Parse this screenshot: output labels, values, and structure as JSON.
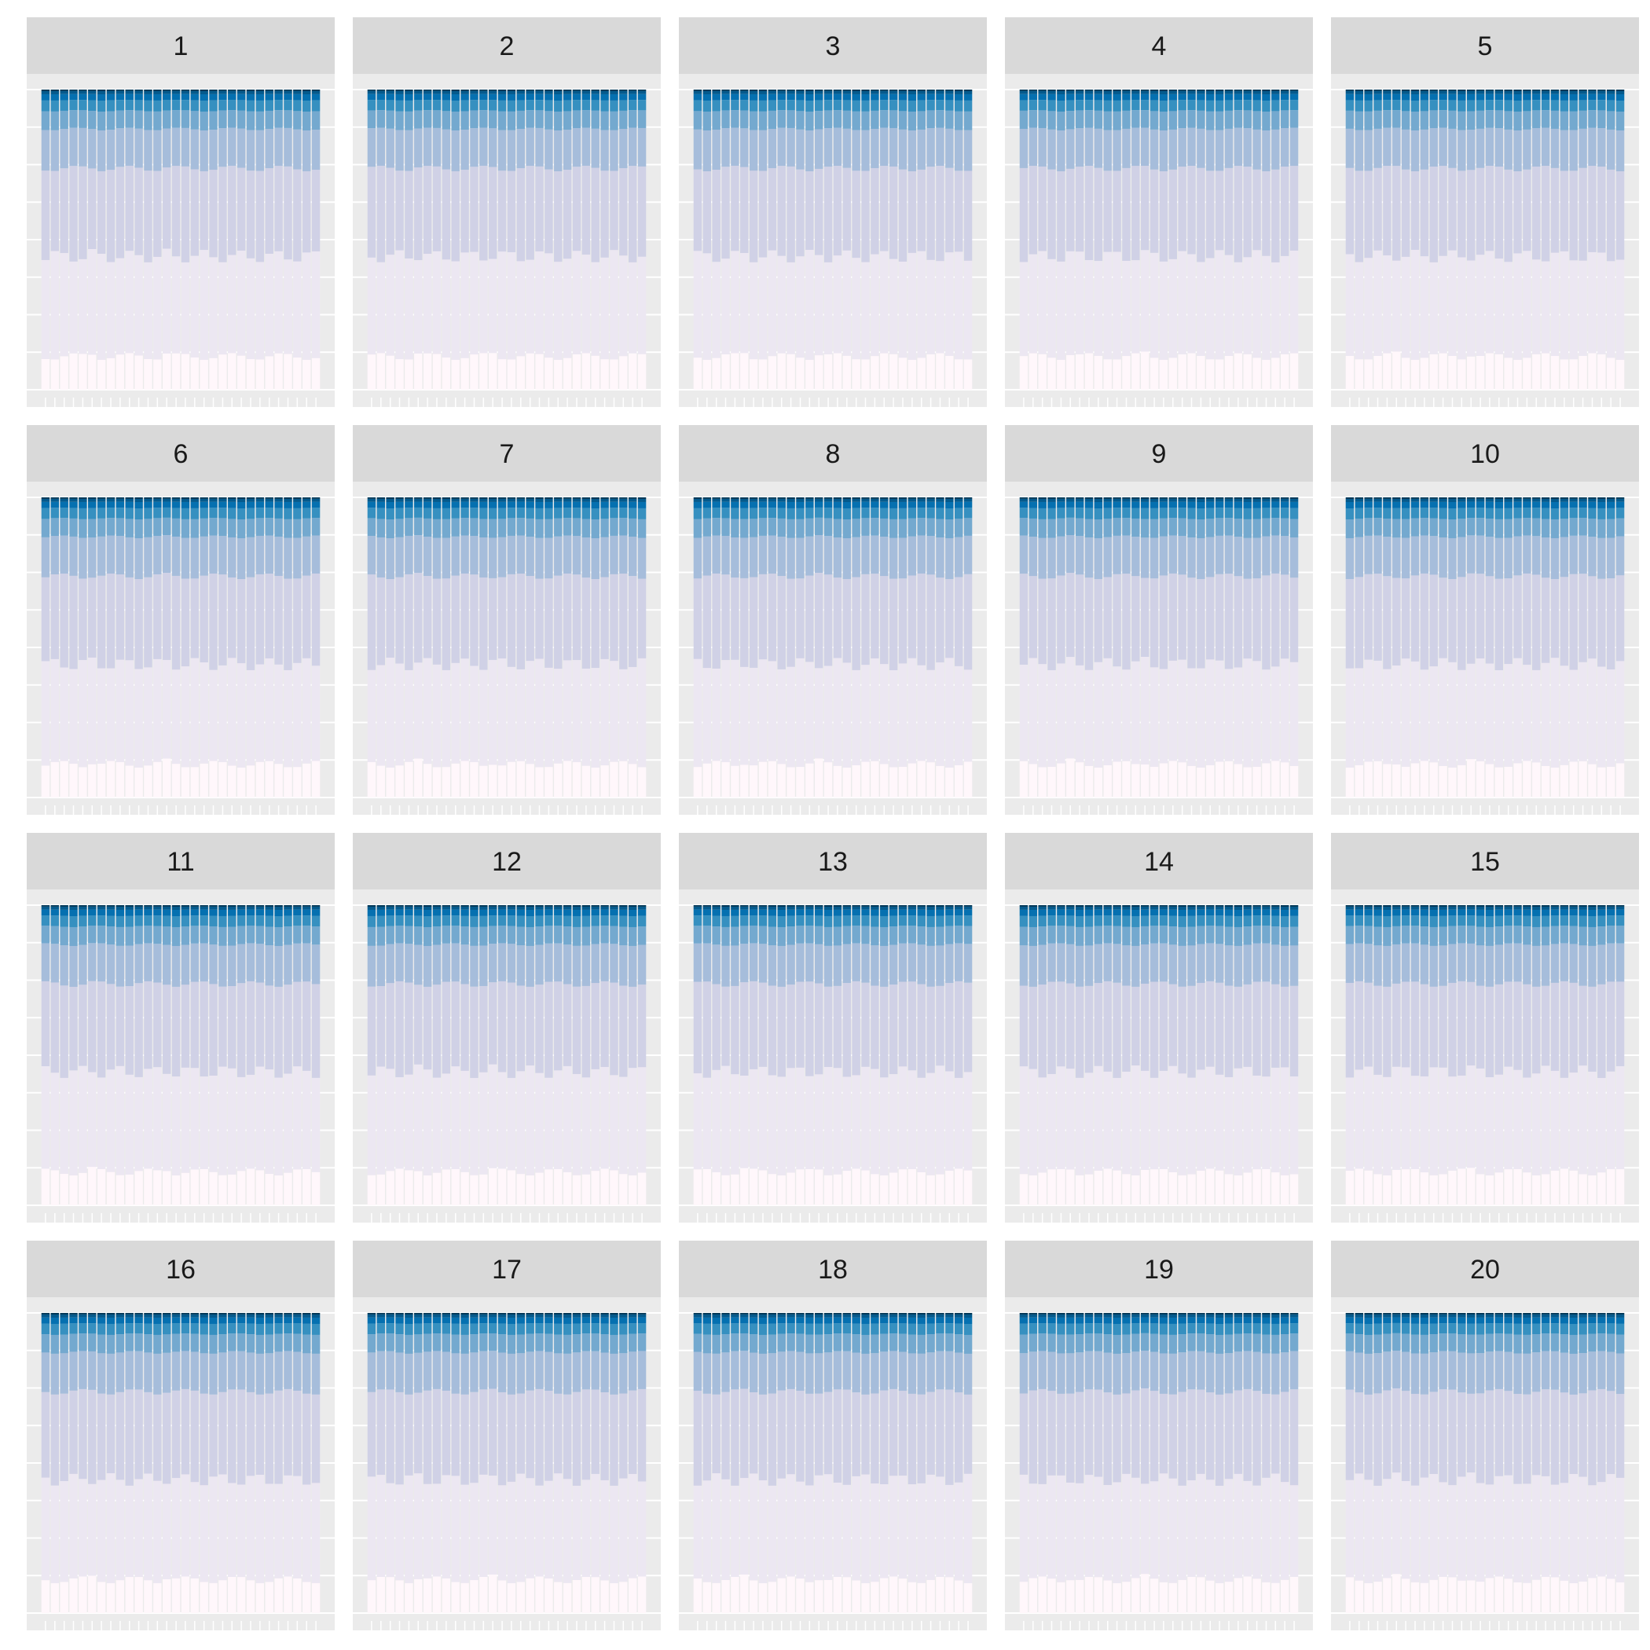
{
  "chart_data": {
    "type": "bar",
    "stacked": true,
    "normalized": true,
    "facet_layout": "5 columns x 4 rows",
    "facets": [
      "1",
      "2",
      "3",
      "4",
      "5",
      "6",
      "7",
      "8",
      "9",
      "10",
      "11",
      "12",
      "13",
      "14",
      "15",
      "16",
      "17",
      "18",
      "19",
      "20"
    ],
    "bars_per_facet": 30,
    "x_tick_labels_shown": false,
    "y_tick_labels_shown": false,
    "legend": "none",
    "ylim": [
      0,
      1
    ],
    "panel_background": "#EBEBEB",
    "grid": true,
    "strip_fill": "#D9D9D9",
    "colors": [
      "#FFF7FB",
      "#ECE7F2",
      "#D0D1E6",
      "#A6BDDB",
      "#74A9CF",
      "#3690C0",
      "#0570B0",
      "#045A8D",
      "#023858"
    ],
    "series": [
      {
        "values": [
          0.11,
          0.11,
          0.11,
          0.11,
          0.11,
          0.12,
          0.11,
          0.11,
          0.11,
          0.11,
          0.11,
          0.11,
          0.11,
          0.12,
          0.11,
          0.11,
          0.11,
          0.11,
          0.11,
          0.11,
          0.11,
          0.11,
          0.11,
          0.11,
          0.11,
          0.11,
          0.11,
          0.11,
          0.11,
          0.11
        ]
      },
      {
        "values": [
          0.33,
          0.33,
          0.33,
          0.33,
          0.33,
          0.33,
          0.33,
          0.33,
          0.33,
          0.33,
          0.33,
          0.33,
          0.33,
          0.33,
          0.33,
          0.33,
          0.33,
          0.33,
          0.33,
          0.33,
          0.33,
          0.33,
          0.33,
          0.33,
          0.33,
          0.33,
          0.33,
          0.33,
          0.33,
          0.33
        ]
      },
      {
        "values": [
          0.29,
          0.29,
          0.29,
          0.29,
          0.29,
          0.29,
          0.29,
          0.29,
          0.29,
          0.29,
          0.29,
          0.29,
          0.29,
          0.29,
          0.29,
          0.29,
          0.29,
          0.29,
          0.29,
          0.29,
          0.29,
          0.29,
          0.29,
          0.29,
          0.29,
          0.29,
          0.29,
          0.29,
          0.29,
          0.29
        ]
      },
      {
        "values": [
          0.13,
          0.13,
          0.13,
          0.13,
          0.13,
          0.13,
          0.13,
          0.13,
          0.13,
          0.13,
          0.13,
          0.13,
          0.13,
          0.13,
          0.13,
          0.13,
          0.13,
          0.13,
          0.13,
          0.13,
          0.13,
          0.13,
          0.13,
          0.13,
          0.13,
          0.13,
          0.13,
          0.13,
          0.13,
          0.13
        ]
      },
      {
        "values": [
          0.06,
          0.06,
          0.06,
          0.06,
          0.06,
          0.06,
          0.06,
          0.06,
          0.06,
          0.06,
          0.06,
          0.06,
          0.06,
          0.06,
          0.06,
          0.06,
          0.06,
          0.06,
          0.06,
          0.06,
          0.06,
          0.06,
          0.06,
          0.06,
          0.06,
          0.06,
          0.06,
          0.06,
          0.06,
          0.06
        ]
      },
      {
        "values": [
          0.035,
          0.035,
          0.035,
          0.035,
          0.035,
          0.035,
          0.035,
          0.035,
          0.035,
          0.035,
          0.035,
          0.035,
          0.035,
          0.035,
          0.035,
          0.035,
          0.035,
          0.035,
          0.035,
          0.035,
          0.035,
          0.035,
          0.035,
          0.035,
          0.035,
          0.035,
          0.035,
          0.035,
          0.035,
          0.035
        ]
      },
      {
        "values": [
          0.02,
          0.02,
          0.02,
          0.02,
          0.02,
          0.02,
          0.02,
          0.02,
          0.02,
          0.02,
          0.02,
          0.02,
          0.02,
          0.02,
          0.02,
          0.02,
          0.02,
          0.02,
          0.02,
          0.02,
          0.02,
          0.02,
          0.02,
          0.02,
          0.02,
          0.02,
          0.02,
          0.02,
          0.02,
          0.02
        ]
      },
      {
        "values": [
          0.01,
          0.01,
          0.01,
          0.01,
          0.01,
          0.01,
          0.01,
          0.01,
          0.01,
          0.01,
          0.01,
          0.01,
          0.01,
          0.01,
          0.01,
          0.01,
          0.01,
          0.01,
          0.01,
          0.01,
          0.01,
          0.01,
          0.01,
          0.01,
          0.01,
          0.01,
          0.01,
          0.01,
          0.01,
          0.01
        ]
      },
      {
        "values": [
          0.005,
          0.005,
          0.005,
          0.005,
          0.005,
          0.005,
          0.005,
          0.005,
          0.005,
          0.005,
          0.005,
          0.005,
          0.005,
          0.005,
          0.005,
          0.005,
          0.005,
          0.005,
          0.005,
          0.005,
          0.005,
          0.005,
          0.005,
          0.005,
          0.005,
          0.005,
          0.005,
          0.005,
          0.005,
          0.005
        ]
      }
    ]
  }
}
